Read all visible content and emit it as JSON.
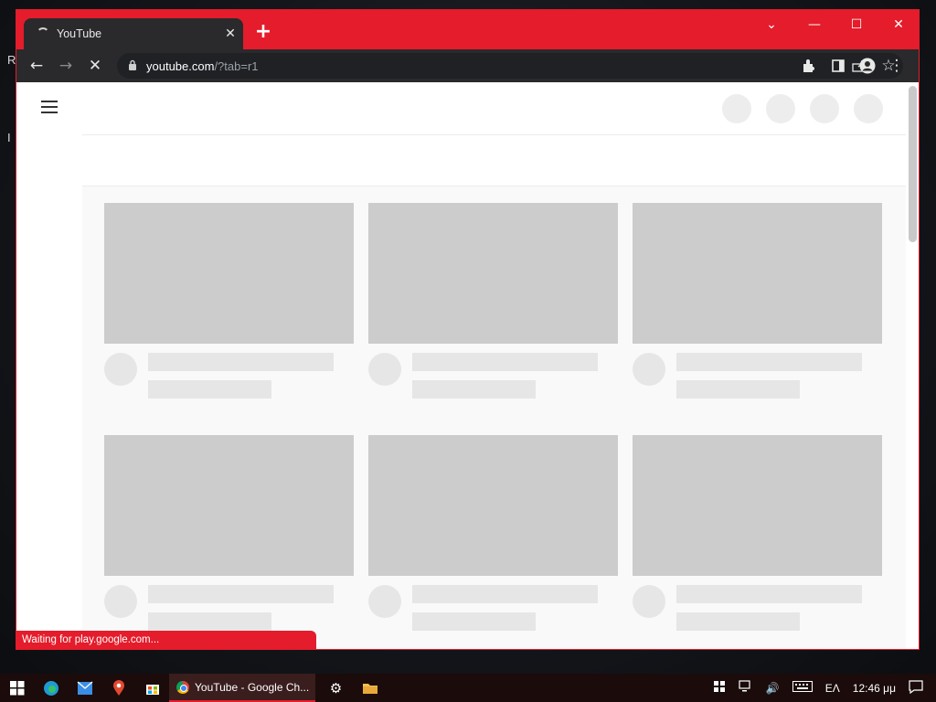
{
  "desktop": {
    "edge_text_1": "R",
    "edge_text_2": "I"
  },
  "browser": {
    "tab": {
      "title": "YouTube",
      "close_glyph": "✕"
    },
    "new_tab_glyph": "+",
    "window_controls": {
      "dropdown": "⌄",
      "minimize": "—",
      "maximize": "☐",
      "close": "✕"
    },
    "url_host": "youtube.com",
    "url_path": "/?tab=r1",
    "nav_icons": {
      "back": "←",
      "forward": "→",
      "stop": "✕",
      "lock": "🔒"
    },
    "status": "Waiting for play.google.com..."
  },
  "taskbar": {
    "start_icon": "windows-icon",
    "active_app": "YouTube - Google Ch...",
    "language": "ΕΛ",
    "time": "12:46 μμ"
  },
  "colors": {
    "accent": "#e41c2b",
    "placeholder": "#cccccc",
    "skeleton": "#e6e6e6"
  }
}
